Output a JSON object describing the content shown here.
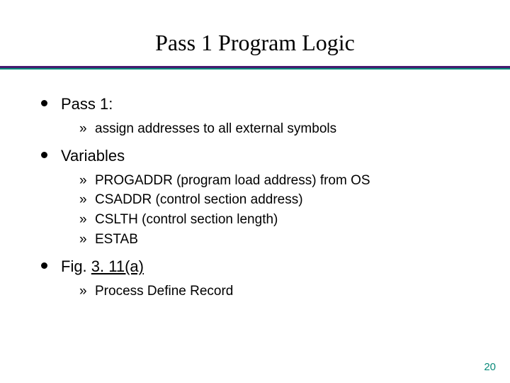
{
  "title": "Pass 1 Program Logic",
  "bullets": [
    {
      "label": "Pass 1:",
      "sub": [
        "assign addresses to all external symbols"
      ]
    },
    {
      "label": "Variables",
      "sub": [
        "PROGADDR (program load address) from OS",
        "CSADDR (control section address)",
        "CSLTH (control section length)",
        "ESTAB"
      ]
    },
    {
      "label_prefix": "Fig. ",
      "label_link": "3. 11(a)",
      "sub": [
        "Process Define Record"
      ]
    }
  ],
  "page_number": "20"
}
